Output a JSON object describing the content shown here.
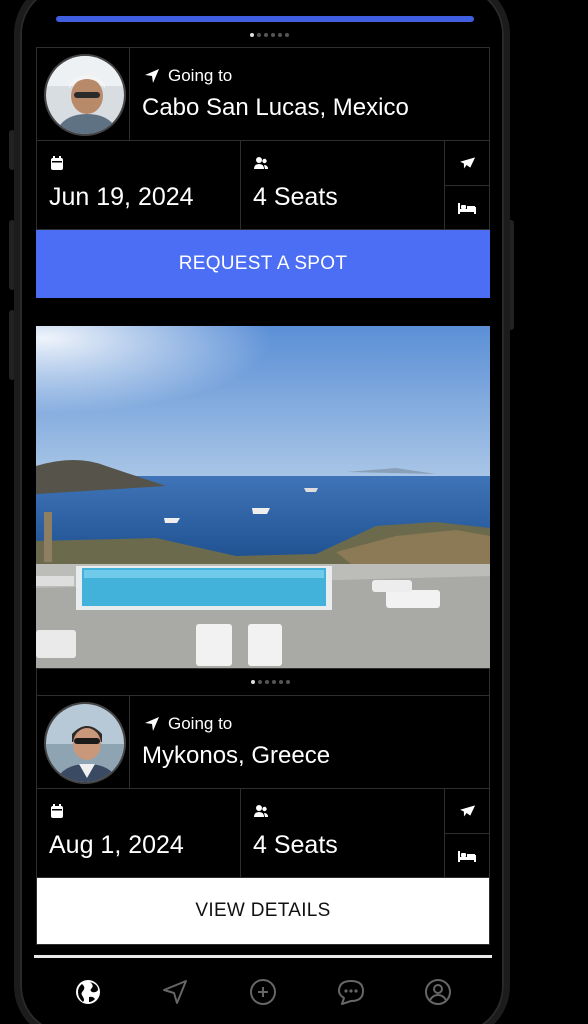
{
  "cards": [
    {
      "going_label": "Going to",
      "destination": "Cabo San Lucas, Mexico",
      "date": "Jun 19, 2024",
      "seats": "4 Seats",
      "cta": "REQUEST A SPOT"
    },
    {
      "going_label": "Going to",
      "destination": "Mykonos, Greece",
      "date": "Aug 1, 2024",
      "seats": "4 Seats",
      "cta": "VIEW DETAILS"
    }
  ],
  "icons": {
    "location": "navigation-arrow-icon",
    "calendar": "calendar-icon",
    "people": "people-icon",
    "flight": "airplane-icon",
    "hotel": "bed-icon"
  },
  "tabbar": [
    {
      "name": "explore",
      "icon": "globe-icon",
      "active": true
    },
    {
      "name": "trips",
      "icon": "send-arrow-icon",
      "active": false
    },
    {
      "name": "create",
      "icon": "plus-circle-icon",
      "active": false
    },
    {
      "name": "messages",
      "icon": "chat-bubble-icon",
      "active": false
    },
    {
      "name": "profile",
      "icon": "user-circle-icon",
      "active": false
    }
  ],
  "colors": {
    "accent": "#4b6ef5",
    "background": "#000000",
    "border": "#2e2e2e"
  }
}
